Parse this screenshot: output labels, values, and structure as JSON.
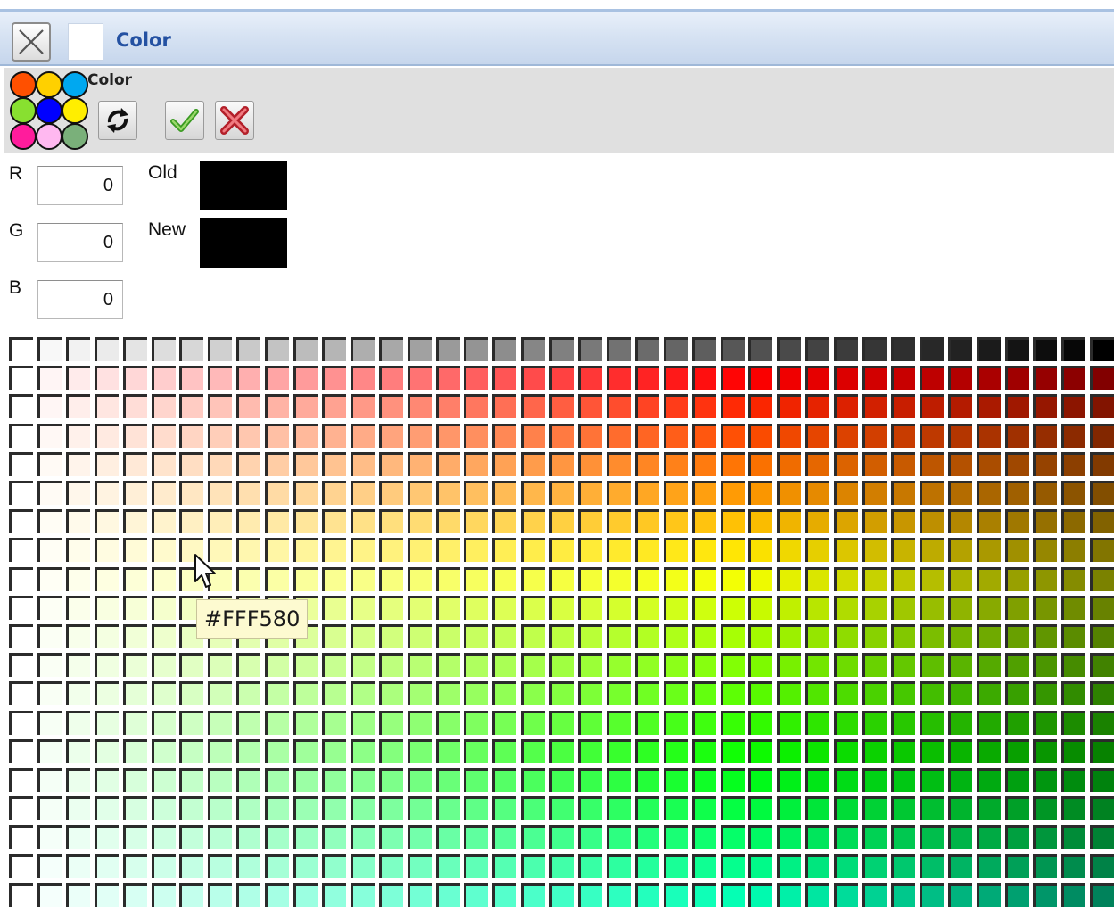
{
  "window": {
    "title": "Color",
    "title_swatch_color": "#FFFFFF",
    "close_icon": "close-icon"
  },
  "toolbar": {
    "label": "Color",
    "palette_icon": "color-palette-icon",
    "palette_colors": [
      "#FF5000",
      "#FFD000",
      "#00A8F0",
      "#88E030",
      "#0000FF",
      "#FFEE00",
      "#FF1C9C",
      "#FFB8F0",
      "#7AB07A"
    ],
    "buttons": [
      {
        "name": "reset-button",
        "icon": "refresh-icon"
      },
      {
        "name": "ok-button",
        "icon": "checkmark-icon"
      },
      {
        "name": "cancel-button",
        "icon": "red-x-icon"
      }
    ]
  },
  "rgb": {
    "r_label": "R",
    "r_value": "0",
    "g_label": "G",
    "g_value": "0",
    "b_label": "B",
    "b_value": "0"
  },
  "compare": {
    "old_label": "Old",
    "old_color": "#000000",
    "new_label": "New",
    "new_color": "#000000"
  },
  "tooltip": {
    "text": "#FFF580"
  }
}
